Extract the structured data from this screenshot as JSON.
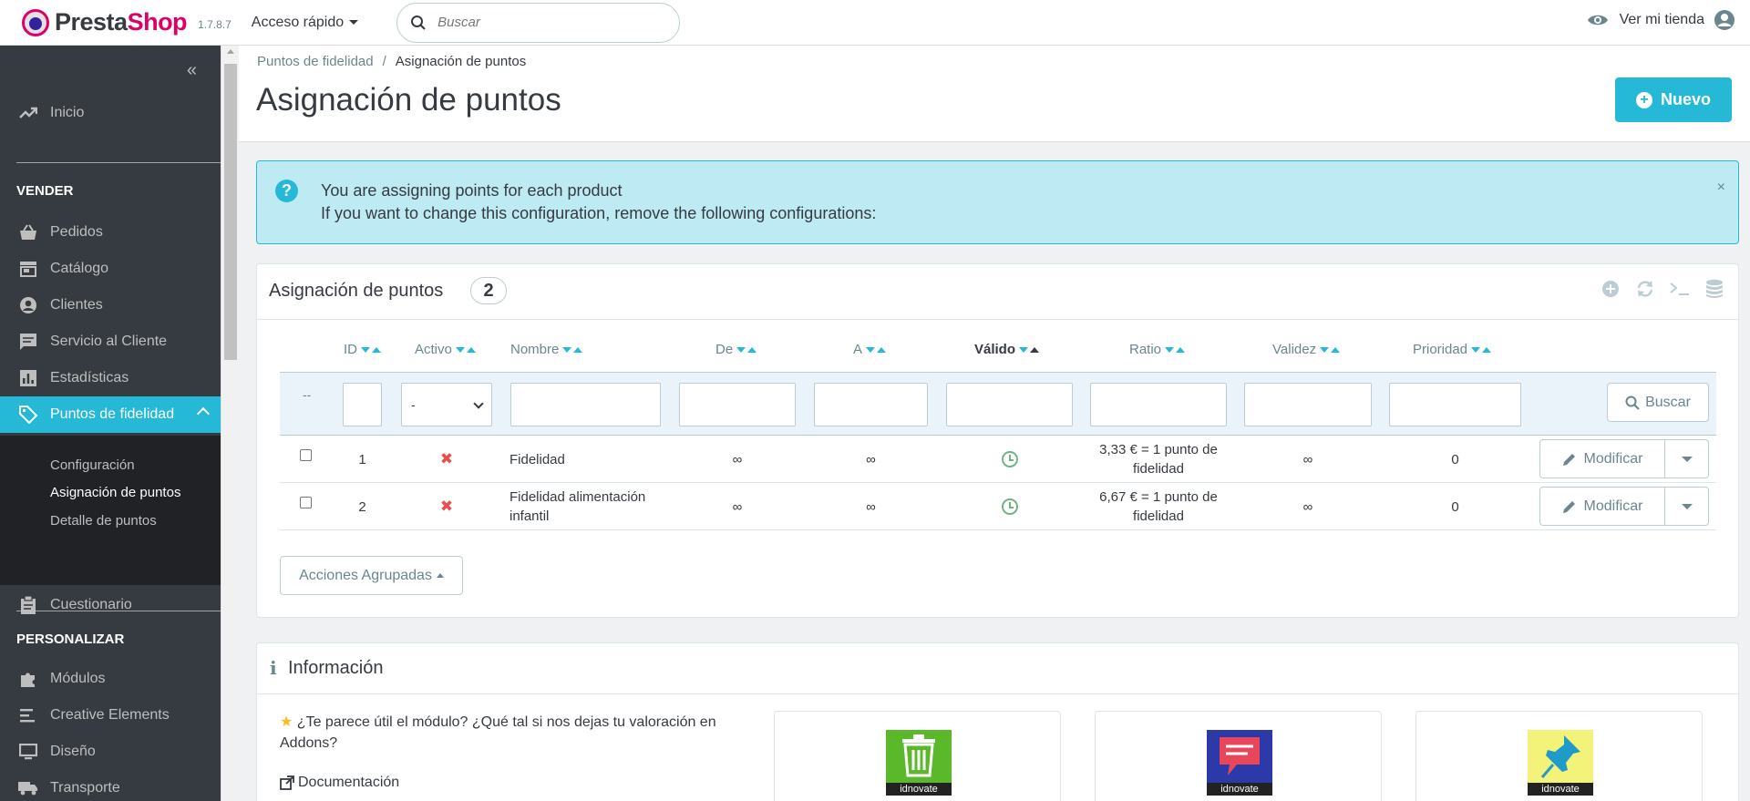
{
  "header": {
    "logo_presta": "Presta",
    "logo_shop": "Shop",
    "version": "1.7.8.7",
    "quick_access": "Acceso rápido",
    "search_placeholder": "Buscar",
    "view_store": "Ver mi tienda"
  },
  "sidebar": {
    "inicio": "Inicio",
    "section_sell": "VENDER",
    "pedidos": "Pedidos",
    "catalogo": "Catálogo",
    "clientes": "Clientes",
    "servicio": "Servicio al Cliente",
    "estadisticas": "Estadísticas",
    "puntos": "Puntos de fidelidad",
    "sub_config": "Configuración",
    "sub_asignacion": "Asignación de puntos",
    "sub_detalle": "Detalle de puntos",
    "cuestionario": "Cuestionario",
    "section_custom": "PERSONALIZAR",
    "modulos": "Módulos",
    "creative": "Creative Elements",
    "diseno": "Diseño",
    "transporte": "Transporte"
  },
  "page": {
    "breadcrumb_parent": "Puntos de fidelidad",
    "breadcrumb_sep": "/",
    "breadcrumb_current": "Asignación de puntos",
    "title": "Asignación de puntos",
    "new_button": "Nuevo"
  },
  "alert": {
    "line1": "You are assigning points for each product",
    "line2": "If you want to change this configuration, remove the following configurations:",
    "close": "×"
  },
  "list": {
    "title": "Asignación de puntos",
    "count": "2",
    "columns": {
      "id": "ID",
      "activo": "Activo",
      "nombre": "Nombre",
      "de": "De",
      "a": "A",
      "valido": "Válido",
      "ratio": "Ratio",
      "validez": "Validez",
      "prioridad": "Prioridad"
    },
    "filter_dash": "--",
    "filter_select": "-",
    "search_button": "Buscar",
    "rows": [
      {
        "id": "1",
        "nombre": "Fidelidad",
        "de": "∞",
        "a": "∞",
        "ratio": "3,33 € = 1 punto de fidelidad",
        "validez": "∞",
        "prioridad": "0",
        "activo_icon": "✖"
      },
      {
        "id": "2",
        "nombre": "Fidelidad alimentación infantil",
        "de": "∞",
        "a": "∞",
        "ratio": "6,67 € = 1 punto de fidelidad",
        "validez": "∞",
        "prioridad": "0",
        "activo_icon": "✖"
      }
    ],
    "edit_button": "Modificar",
    "bulk_actions": "Acciones Agrupadas"
  },
  "info": {
    "title": "Información",
    "rate_text": "¿Te parece útil el módulo? ¿Qué tal si nos dejas tu valoración en Addons?",
    "documentation": "Documentación",
    "brand": "idnovate"
  },
  "colors": {
    "accent": "#25b9d7",
    "sidebar_bg": "#363a41",
    "alert_bg": "#bdeaf3",
    "inactive_red": "#e84e4e",
    "valid_green": "#70b580"
  }
}
